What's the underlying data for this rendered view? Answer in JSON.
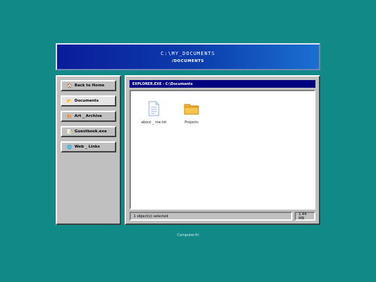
{
  "header": {
    "path": "C:\\MY_DOCUMENTS",
    "subtitle": "/DOCUMENTS"
  },
  "sidebar": {
    "items": [
      {
        "label": "Back to Home",
        "icon": "house-icon",
        "glyph": "🏠"
      },
      {
        "label": "Documents",
        "icon": "folder-icon",
        "glyph": "📂",
        "active": true
      },
      {
        "label": "Art _ Archive",
        "icon": "palette-icon",
        "glyph": "🎨"
      },
      {
        "label": "Guestbook.exe",
        "icon": "notepad-icon",
        "glyph": "📝"
      },
      {
        "label": "Web _ Links",
        "icon": "globe-icon",
        "glyph": "🌐"
      }
    ]
  },
  "window": {
    "title": "EXPLORER.EXE - C:\\Documents",
    "files": [
      {
        "name": "about _ me.txt",
        "icon": "text-file-icon"
      },
      {
        "name": "Projects",
        "icon": "folder-icon"
      }
    ],
    "status": {
      "selection": "1 object(s) selected",
      "size": "1.44 MB"
    }
  },
  "footer": {
    "text": "Computer.fri"
  },
  "colors": {
    "desktop": "#118a87",
    "titlebar": "#000080",
    "banner_start": "#0a1c9a",
    "banner_end": "#1a6fd0",
    "panel": "#c0c0c0"
  }
}
